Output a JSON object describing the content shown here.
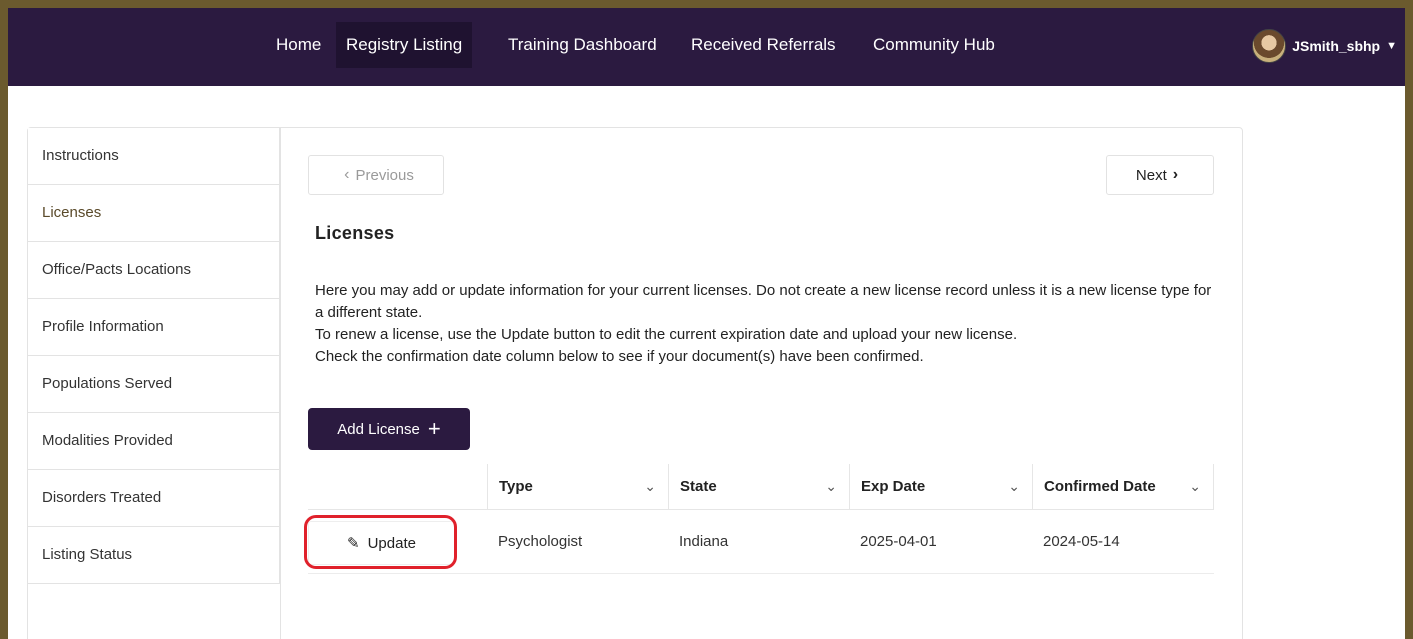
{
  "nav": {
    "items": [
      {
        "label": "Home"
      },
      {
        "label": "Registry Listing"
      },
      {
        "label": "Training Dashboard"
      },
      {
        "label": "Received Referrals"
      },
      {
        "label": "Community Hub"
      }
    ],
    "active": "Registry Listing",
    "user": {
      "name": "JSmith_sbhp"
    }
  },
  "sidebar": {
    "items": [
      {
        "label": "Instructions"
      },
      {
        "label": "Licenses"
      },
      {
        "label": "Office/Pacts Locations"
      },
      {
        "label": "Profile Information"
      },
      {
        "label": "Populations Served"
      },
      {
        "label": "Modalities Provided"
      },
      {
        "label": "Disorders Treated"
      },
      {
        "label": "Listing Status"
      }
    ],
    "active": "Licenses"
  },
  "pager": {
    "previous_label": "Previous",
    "next_label": "Next"
  },
  "section": {
    "title": "Licenses",
    "description": [
      "Here you may add or update information for your current licenses. Do not create a new license record unless it is a new license type for a different state.",
      "To renew a license, use the Update button to edit the current expiration date and upload your new license.",
      "Check the confirmation date column below to see if your document(s) have been confirmed."
    ],
    "add_button_label": "Add License"
  },
  "table": {
    "columns": [
      "Type",
      "State",
      "Exp Date",
      "Confirmed Date"
    ],
    "rows": [
      {
        "action": "Update",
        "type": "Psychologist",
        "state": "Indiana",
        "exp_date": "2025-04-01",
        "confirmed_date": "2024-05-14"
      }
    ]
  },
  "colors": {
    "navbar": "#2b1a40",
    "frame_border": "#6b5a2e",
    "highlight": "#e0212b"
  }
}
